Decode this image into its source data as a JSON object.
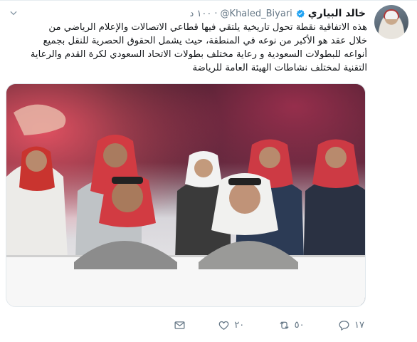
{
  "tweet": {
    "name": "خالد البياري",
    "handle": "@Khaled_Biyari",
    "separator": "·",
    "time": "١٠٠ د",
    "text": "هذه الاتفاقية نقطة تحول تاريخية يلتقي فيها قطاعي الاتصالات والإعلام الرياضي من\nخلال عقد هو الأكبر من نوعه في المنطقة، حيث يشمل الحقوق الحصرية للنقل بجميع\nأنواعه للبطولات السعودية و رعاية مختلف بطولات الاتحاد السعودي لكرة القدم والرعاية\nالتقنية لمختلف نشاطات الهيئة العامة للرياضة",
    "verified": true
  },
  "actions": {
    "reply_count": "١٧",
    "retweet_count": "٥٠",
    "like_count": "٢٠",
    "icons": [
      "reply-icon",
      "retweet-icon",
      "like-icon",
      "message-icon"
    ]
  },
  "colors": {
    "text": "#14171a",
    "secondary": "#657786",
    "verified": "#1da1f2",
    "border": "#e1e8ed"
  }
}
